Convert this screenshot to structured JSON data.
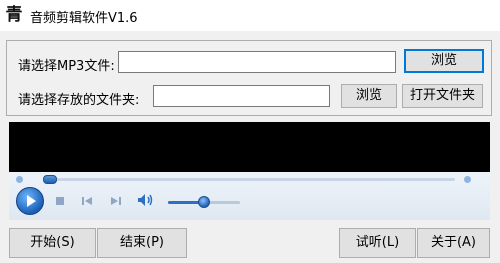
{
  "window": {
    "title": "音频剪辑软件V1.6",
    "icon_char": "青"
  },
  "mp3": {
    "label": "请选择MP3文件:",
    "value": "",
    "browse_label": "浏览"
  },
  "folder": {
    "label": "请选择存放的文件夹:",
    "value": "",
    "browse_label": "浏览",
    "open_label": "打开文件夹"
  },
  "player": {
    "play_icon": "play-icon",
    "stop_icon": "stop-icon",
    "prev_icon": "previous-icon",
    "next_icon": "next-icon",
    "volume_icon": "speaker-icon",
    "seek_progress": 0.0,
    "volume_level": 0.5
  },
  "actions": {
    "start_label": "开始(S)",
    "end_label": "结束(P)",
    "preview_label": "试听(L)",
    "about_label": "关于(A)"
  },
  "colors": {
    "video_bg": "#000000",
    "accent": "#0078d7"
  }
}
